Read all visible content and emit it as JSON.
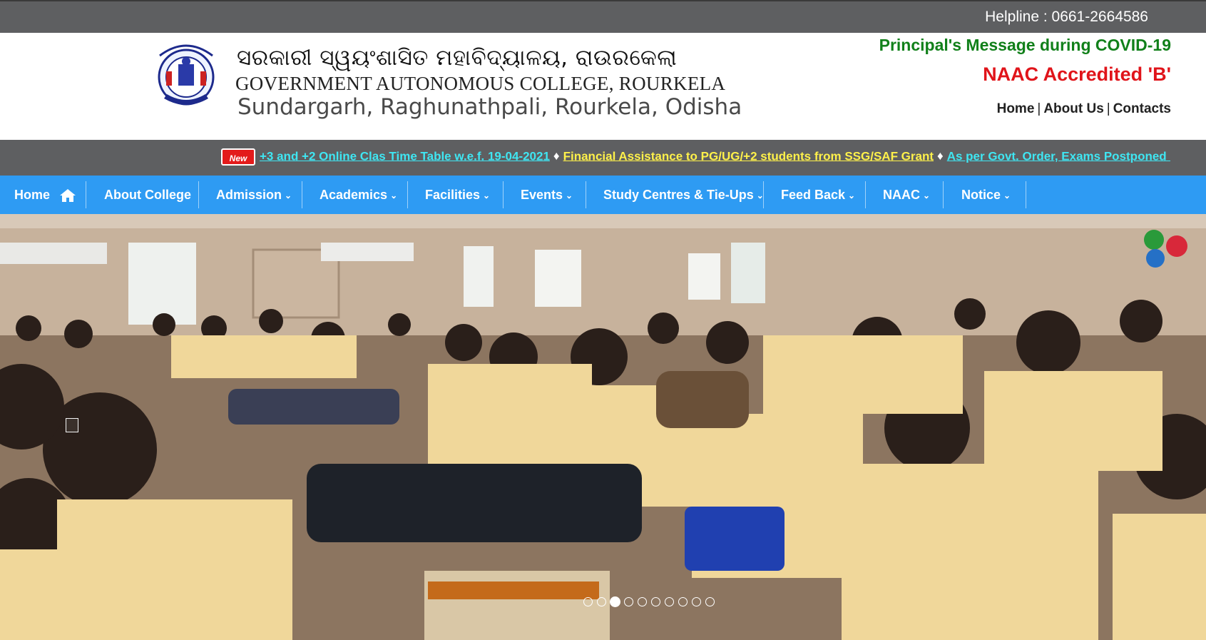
{
  "topbar": {
    "helpline": "Helpline : 0661-2664586"
  },
  "header": {
    "odia_title": "ସରକାରୀ ସ୍ୱୟଂଶାସିତ ମହାବିଦ୍ୟାଳୟ, ରାଉରକେଲା",
    "college_name": "GOVERNMENT AUTONOMOUS COLLEGE, ROURKELA",
    "address": "Sundargarh, Raghunathpali, Rourkela, Odisha",
    "principal_message": "Principal's Message during COVID-19",
    "naac": "NAAC Accredited 'B'",
    "links": [
      "Home",
      "About Us",
      "Contacts"
    ]
  },
  "ticker": {
    "badge": "New",
    "items": [
      "+3 and +2 Online Clas Time Table w.e.f. 19-04-2021",
      "Financial Assistance to PG/UG/+2 students from SSG/SAF Grant",
      "As per Govt. Order, Exams Postponed - Classes to be held Onl"
    ],
    "separator": "♦"
  },
  "nav": {
    "items": [
      {
        "label": "Home",
        "icon": "home-icon"
      },
      {
        "label": "About College"
      },
      {
        "label": "Admission",
        "dropdown": true
      },
      {
        "label": "Academics",
        "dropdown": true
      },
      {
        "label": "Facilities",
        "dropdown": true
      },
      {
        "label": "Events",
        "dropdown": true
      },
      {
        "label": "Study Centres & Tie-Ups",
        "dropdown": true
      },
      {
        "label": "Feed Back",
        "dropdown": true
      },
      {
        "label": "NAAC",
        "dropdown": true
      },
      {
        "label": "Notice",
        "dropdown": true
      }
    ],
    "chevron": "⌄"
  },
  "slider": {
    "total_slides": 10,
    "active_slide": 3
  },
  "colors": {
    "topbar": "#5e5f61",
    "nav": "#2e9bf3",
    "principal": "#11801a",
    "naac": "#e0141a",
    "ticker_cyan": "#3fe6f2",
    "ticker_yellow": "#fff14a"
  }
}
